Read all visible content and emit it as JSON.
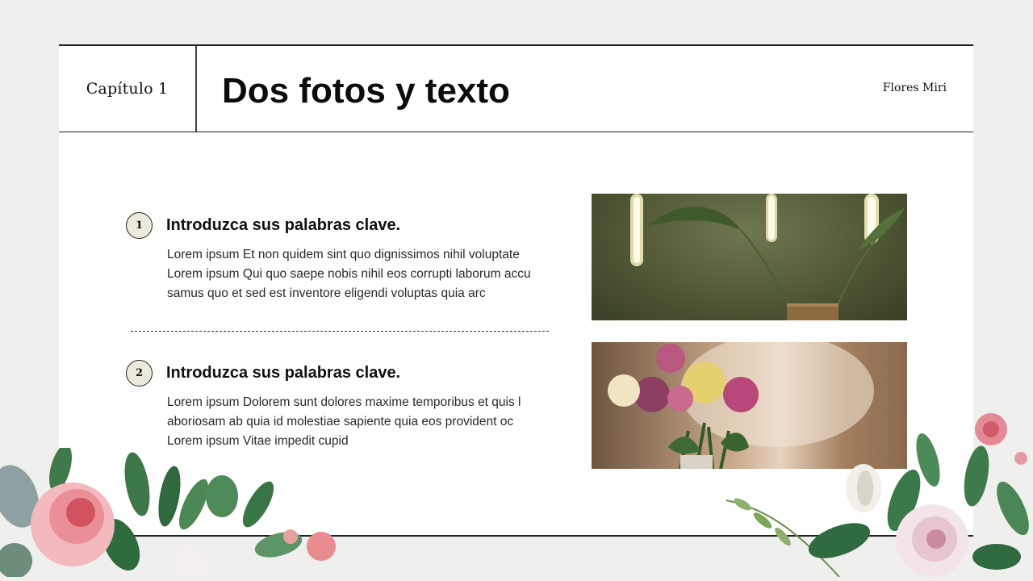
{
  "header": {
    "chapter": "Capítulo 1",
    "title": "Dos fotos y texto",
    "author": "Flores Miri"
  },
  "items": [
    {
      "number": "1",
      "title": "Introduzca sus palabras clave.",
      "lines": [
        "Lorem ipsum Et non quidem sint quo dignissimos nihil voluptate",
        "Lorem ipsum Qui quo saepe nobis nihil eos corrupti laborum accu",
        "samus quo et sed est inventore eligendi voluptas quia arc"
      ]
    },
    {
      "number": "2",
      "title": "Introduzca sus palabras clave.",
      "lines": [
        "Lorem ipsum Dolorem sunt dolores maxime temporibus et quis l",
        "aboriosam ab quia id molestiae sapiente quia eos provident oc",
        "Lorem ipsum Vitae impedit cupid"
      ]
    }
  ],
  "colors": {
    "background": "#efefed",
    "slide": "#ffffff",
    "number_badge": "#eceadd",
    "rule": "#222222"
  },
  "icons": {
    "photo_1": "plant-and-bulbs-photo",
    "photo_2": "flower-bouquet-photo",
    "decor_left": "floral-left-icon",
    "decor_right": "floral-right-icon"
  }
}
